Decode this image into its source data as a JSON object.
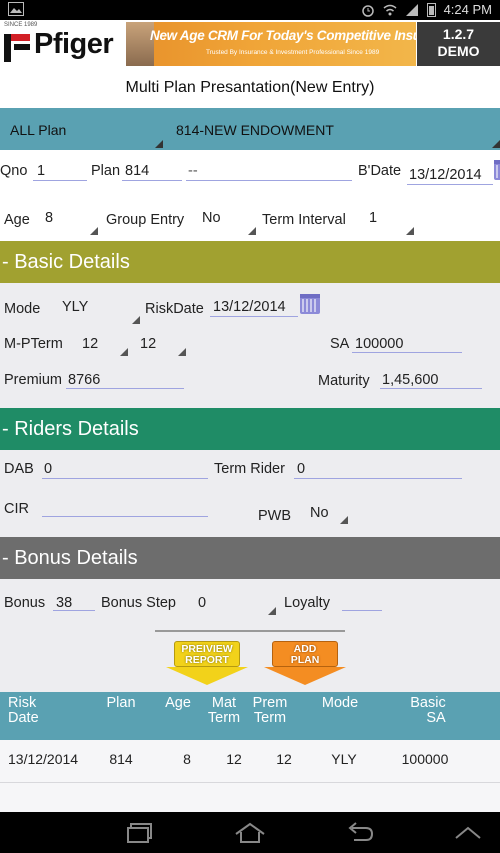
{
  "status_bar": {
    "time": "4:24 PM"
  },
  "header": {
    "logo_since": "SINCE 1989",
    "logo_text": "Pfiger",
    "banner_title": "New Age CRM For Today's Competitive Insurance Business",
    "banner_subtitle": "Trusted By Insurance & Investment Professional Since 1989",
    "version": "1.2.7",
    "mode": "DEMO"
  },
  "page_title": "Multi Plan Presantation(New Entry)",
  "plan_selector": {
    "category": "ALL Plan",
    "plan": "814-NEW ENDOWMENT"
  },
  "row1": {
    "qno_label": "Qno",
    "qno_value": "1",
    "plan_label": "Plan",
    "plan_value": "814",
    "plan_name": "--",
    "bdate_label": "B'Date",
    "bdate_value": "13/12/2014"
  },
  "row2": {
    "age_label": "Age",
    "age_value": "8",
    "group_label": "Group Entry",
    "group_value": "No",
    "term_interval_label": "Term Interval",
    "term_interval_value": "1"
  },
  "basic": {
    "title": "- Basic Details",
    "mode_label": "Mode",
    "mode_value": "YLY",
    "riskdate_label": "RiskDate",
    "riskdate_value": "13/12/2014",
    "mpterm_label": "M-PTerm",
    "mterm_value": "12",
    "pterm_value": "12",
    "sa_label": "SA",
    "sa_value": "100000",
    "premium_label": "Premium",
    "premium_value": "8766",
    "maturity_label": "Maturity",
    "maturity_value": "1,45,600"
  },
  "riders": {
    "title": "- Riders Details",
    "dab_label": "DAB",
    "dab_value": "0",
    "term_rider_label": "Term Rider",
    "term_rider_value": "0",
    "cir_label": "CIR",
    "cir_value": "",
    "pwb_label": "PWB",
    "pwb_value": "No"
  },
  "bonus": {
    "title": "- Bonus Details",
    "bonus_label": "Bonus",
    "bonus_value": "38",
    "bonus_step_label": "Bonus Step",
    "bonus_step_value": "0",
    "loyalty_label": "Loyalty",
    "loyalty_value": ""
  },
  "buttons": {
    "preview_line1": "PREIVIEW",
    "preview_line2": "REPORT",
    "add_line1": "ADD",
    "add_line2": "PLAN"
  },
  "table": {
    "headers": [
      {
        "line1": "Risk",
        "line2": "Date"
      },
      {
        "line1": "Plan",
        "line2": ""
      },
      {
        "line1": "Age",
        "line2": ""
      },
      {
        "line1": "Mat",
        "line2": "Term"
      },
      {
        "line1": "Prem",
        "line2": "Term"
      },
      {
        "line1": "Mode",
        "line2": ""
      },
      {
        "line1": "Basic",
        "line2": "SA"
      }
    ],
    "rows": [
      [
        "13/12/2014",
        "814",
        "8",
        "12",
        "12",
        "YLY",
        "100000"
      ]
    ]
  }
}
